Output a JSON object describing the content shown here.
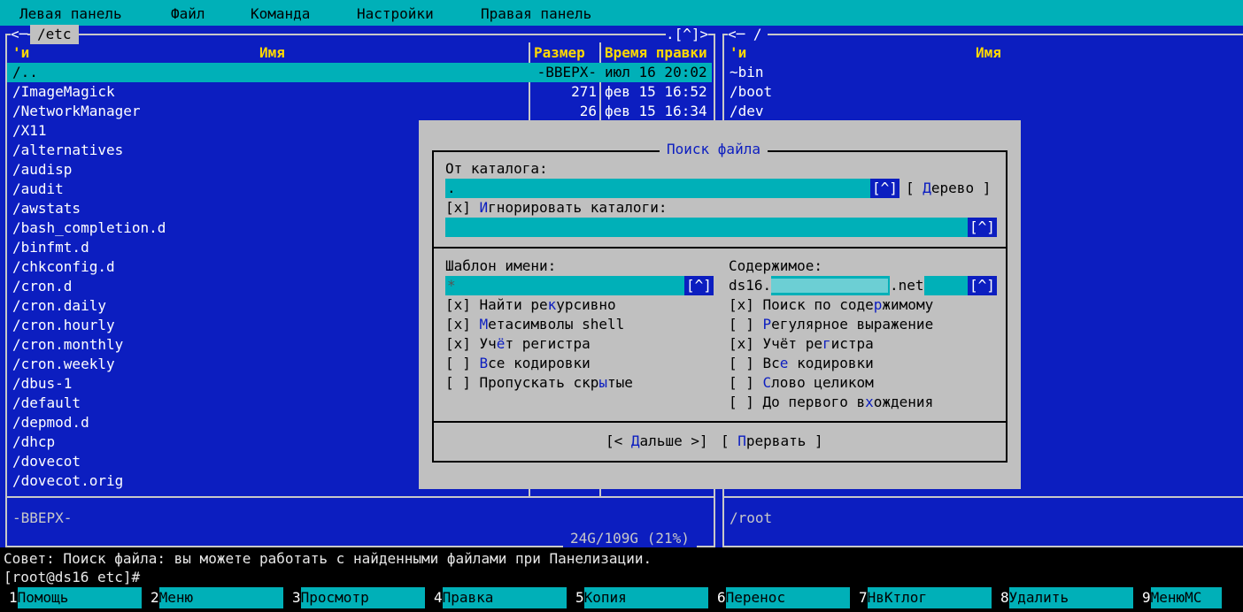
{
  "menu": [
    "Левая панель",
    "Файл",
    "Команда",
    "Настройки",
    "Правая панель"
  ],
  "left_panel": {
    "path": "/etc",
    "corner_left": "<─",
    "history_btn": ".[^]>",
    "col_flag": "'и",
    "col_name": "Имя",
    "col_size": "Размер",
    "col_time": "Время правки",
    "rows": [
      {
        "name": "/..",
        "size": "-ВВЕРХ-",
        "time": "июл 16 20:02"
      },
      {
        "name": "/ImageMagick",
        "size": "271",
        "time": "фев 15 16:52"
      },
      {
        "name": "/NetworkManager",
        "size": "26",
        "time": "фев 15 16:34"
      },
      {
        "name": "/X11",
        "size": "",
        "time": ""
      },
      {
        "name": "/alternatives",
        "size": "",
        "time": ""
      },
      {
        "name": "/audisp",
        "size": "",
        "time": ""
      },
      {
        "name": "/audit",
        "size": "",
        "time": ""
      },
      {
        "name": "/awstats",
        "size": "",
        "time": ""
      },
      {
        "name": "/bash_completion.d",
        "size": "",
        "time": ""
      },
      {
        "name": "/binfmt.d",
        "size": "",
        "time": ""
      },
      {
        "name": "/chkconfig.d",
        "size": "",
        "time": ""
      },
      {
        "name": "/cron.d",
        "size": "",
        "time": ""
      },
      {
        "name": "/cron.daily",
        "size": "",
        "time": ""
      },
      {
        "name": "/cron.hourly",
        "size": "",
        "time": ""
      },
      {
        "name": "/cron.monthly",
        "size": "",
        "time": ""
      },
      {
        "name": "/cron.weekly",
        "size": "",
        "time": ""
      },
      {
        "name": "/dbus-1",
        "size": "",
        "time": ""
      },
      {
        "name": "/default",
        "size": "",
        "time": ""
      },
      {
        "name": "/depmod.d",
        "size": "",
        "time": ""
      },
      {
        "name": "/dhcp",
        "size": "",
        "time": ""
      },
      {
        "name": "/dovecot",
        "size": "",
        "time": ""
      },
      {
        "name": "/dovecot.orig",
        "size": "",
        "time": ""
      }
    ],
    "status": "-ВВЕРХ-",
    "disk": "24G/109G (21%)"
  },
  "right_panel": {
    "path": "<─ /",
    "col_flag": "'и",
    "col_name": "Имя",
    "rows": [
      "~bin",
      "/boot",
      "/dev"
    ],
    "status": "/root"
  },
  "dialog": {
    "title": "Поиск файла",
    "from_dir_label": "От каталога:",
    "from_dir_value": ".",
    "hist": "[^]",
    "tree_btn_open": "[ ",
    "tree_btn_hot": "Д",
    "tree_btn_rest": "ерево ]",
    "ignore_dirs": {
      "box": "[x] ",
      "hot": "И",
      "rest": "гнорировать каталоги:"
    },
    "ignore_dirs_value": "",
    "name_pattern_label": "Шаблон имени:",
    "name_pattern_value": "*",
    "content_label": "Содержимое:",
    "content_value_prefix": "ds16.",
    "content_value_suffix": ".net",
    "left_options": [
      {
        "box": "[x] ",
        "pre": "Найти ре",
        "hot": "к",
        "post": "урсивно"
      },
      {
        "box": "[x] ",
        "pre": "",
        "hot": "М",
        "post": "етасимволы shell"
      },
      {
        "box": "[x] ",
        "pre": "Уч",
        "hot": "ё",
        "post": "т регистра"
      },
      {
        "box": "[ ] ",
        "pre": "",
        "hot": "В",
        "post": "се кодировки"
      },
      {
        "box": "[ ] ",
        "pre": "Пропускать скр",
        "hot": "ы",
        "post": "тые"
      }
    ],
    "right_options": [
      {
        "box": "[x] ",
        "pre": "Поиск по соде",
        "hot": "р",
        "post": "жимому"
      },
      {
        "box": "[ ] ",
        "pre": "",
        "hot": "Р",
        "post": "егулярное выражение"
      },
      {
        "box": "[x] ",
        "pre": "Учёт ре",
        "hot": "г",
        "post": "истра"
      },
      {
        "box": "[ ] ",
        "pre": "Вс",
        "hot": "е",
        "post": " кодировки"
      },
      {
        "box": "[ ] ",
        "pre": "",
        "hot": "С",
        "post": "лово целиком"
      },
      {
        "box": "[ ] ",
        "pre": "До первого в",
        "hot": "х",
        "post": "ождения"
      }
    ],
    "next_btn": {
      "pre": "[< ",
      "hot": "Д",
      "post": "альше >]"
    },
    "abort_btn": {
      "pre": "[ ",
      "hot": "П",
      "post": "рервать ]"
    }
  },
  "hint": "Совет: Поиск файла: вы можете работать с найденными файлами при Панелизации.",
  "prompt": "[root@ds16 etc]#",
  "fkeys": [
    {
      "n": "1",
      "label": "Помощь"
    },
    {
      "n": "2",
      "label": "Меню"
    },
    {
      "n": "3",
      "label": "Просмотр"
    },
    {
      "n": "4",
      "label": "Правка"
    },
    {
      "n": "5",
      "label": "Копия"
    },
    {
      "n": "6",
      "label": "Перенос"
    },
    {
      "n": "7",
      "label": "НвКтлог"
    },
    {
      "n": "8",
      "label": "Удалить"
    },
    {
      "n": "9",
      "label": "МенюMC"
    }
  ],
  "colors": {
    "panel": "#0c1ec0",
    "cyan": "#00b0b8",
    "header": "#ffd800",
    "dialog": "#c0c0c0"
  }
}
